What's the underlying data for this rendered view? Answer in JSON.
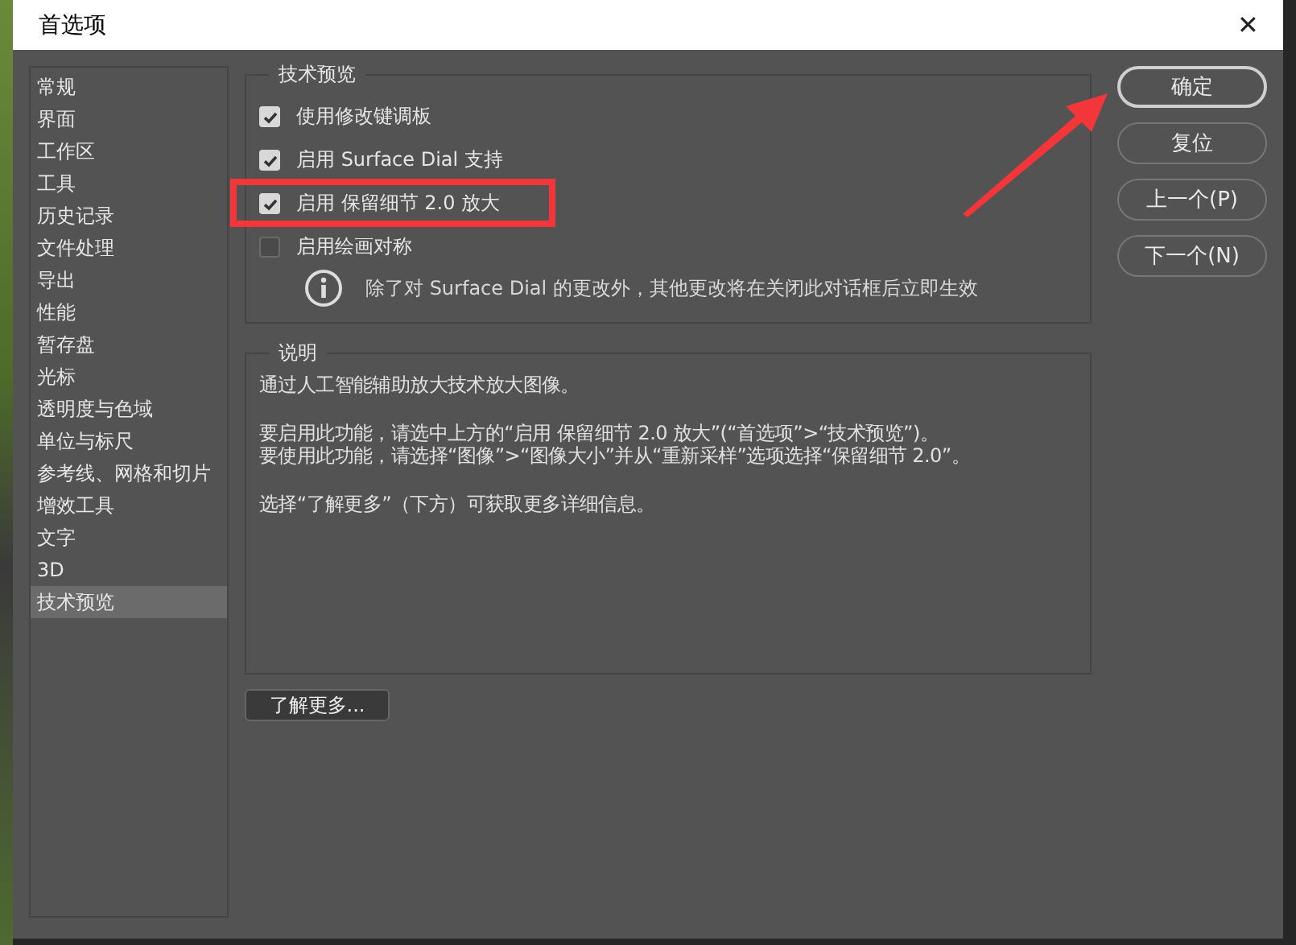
{
  "window": {
    "title": "首选项",
    "close": "✕"
  },
  "sidebar": {
    "items": [
      {
        "label": "常规",
        "selected": false
      },
      {
        "label": "界面",
        "selected": false
      },
      {
        "label": "工作区",
        "selected": false
      },
      {
        "label": "工具",
        "selected": false
      },
      {
        "label": "历史记录",
        "selected": false
      },
      {
        "label": "文件处理",
        "selected": false
      },
      {
        "label": "导出",
        "selected": false
      },
      {
        "label": "性能",
        "selected": false
      },
      {
        "label": "暂存盘",
        "selected": false
      },
      {
        "label": "光标",
        "selected": false
      },
      {
        "label": "透明度与色域",
        "selected": false
      },
      {
        "label": "单位与标尺",
        "selected": false
      },
      {
        "label": "参考线、网格和切片",
        "selected": false
      },
      {
        "label": "增效工具",
        "selected": false
      },
      {
        "label": "文字",
        "selected": false
      },
      {
        "label": "3D",
        "selected": false
      },
      {
        "label": "技术预览",
        "selected": true
      }
    ]
  },
  "tech_preview": {
    "title": "技术预览",
    "options": [
      {
        "label": "使用修改键调板",
        "checked": true
      },
      {
        "label": "启用 Surface Dial 支持",
        "checked": true
      },
      {
        "label": "启用 保留细节 2.0 放大",
        "checked": true
      },
      {
        "label": "启用绘画对称",
        "checked": false
      }
    ],
    "note": "除了对 Surface Dial 的更改外，其他更改将在关闭此对话框后立即生效"
  },
  "description": {
    "title": "说明",
    "paragraphs": [
      {
        "lines": [
          "通过人工智能辅助放大技术放大图像。"
        ]
      },
      {
        "lines": [
          "要启用此功能，请选中上方的“启用 保留细节 2.0 放大”(“首选项”>“技术预览”)。",
          "要使用此功能，请选择“图像”>“图像大小”并从“重新采样”选项选择“保留细节 2.0”。"
        ]
      },
      {
        "lines": [
          "选择“了解更多”（下方）可获取更多详细信息。"
        ]
      }
    ]
  },
  "learn_more": "了解更多...",
  "buttons": [
    {
      "label": "确定",
      "default": true
    },
    {
      "label": "复位",
      "default": false
    },
    {
      "label": "上一个(P)",
      "default": false
    },
    {
      "label": "下一个(N)",
      "default": false
    }
  ]
}
